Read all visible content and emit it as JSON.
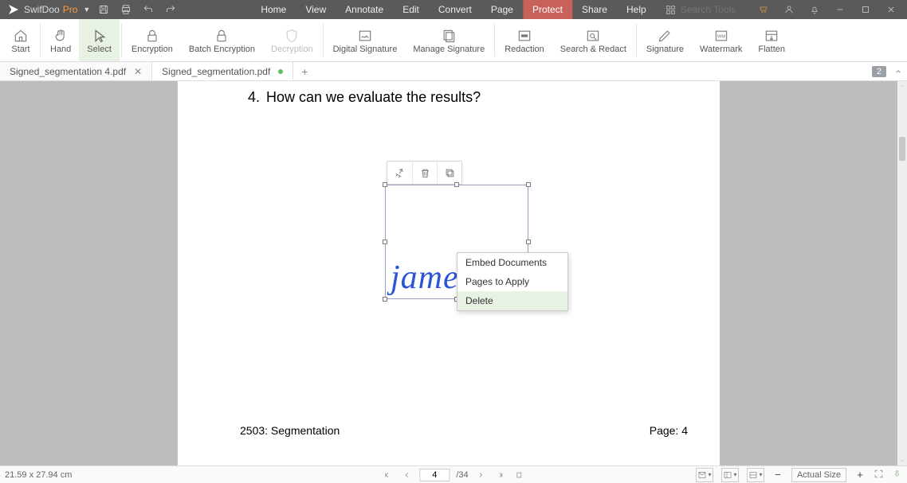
{
  "app": {
    "brand_main": "SwifDoo",
    "brand_suffix": " Pro",
    "search_placeholder": "Search Tools"
  },
  "menus": [
    "Home",
    "View",
    "Annotate",
    "Edit",
    "Convert",
    "Page",
    "Protect",
    "Share",
    "Help"
  ],
  "menus_active_index": 6,
  "ribbon": [
    {
      "label": "Start",
      "icon": "home"
    },
    {
      "label": "Hand",
      "icon": "hand"
    },
    {
      "label": "Select",
      "icon": "cursor",
      "active": true
    },
    {
      "label": "Encryption",
      "icon": "lock"
    },
    {
      "label": "Batch Encryption",
      "icon": "lock"
    },
    {
      "label": "Decryption",
      "icon": "shield",
      "disabled": true
    },
    {
      "label": "Digital Signature",
      "icon": "signature"
    },
    {
      "label": "Manage Signature",
      "icon": "stack"
    },
    {
      "label": "Redaction",
      "icon": "redact"
    },
    {
      "label": "Search & Redact",
      "icon": "searchredact"
    },
    {
      "label": "Signature",
      "icon": "pen"
    },
    {
      "label": "Watermark",
      "icon": "watermark"
    },
    {
      "label": "Flatten",
      "icon": "flatten"
    }
  ],
  "ribbon_separators_after": [
    0,
    2,
    5,
    7,
    9
  ],
  "tabs": [
    {
      "label": "Signed_segmentation 4.pdf",
      "active": false,
      "modified": false
    },
    {
      "label": "Signed_segmentation.pdf",
      "active": true,
      "modified": true
    }
  ],
  "tab_count_badge": "2",
  "document": {
    "question_number": "4.",
    "question_text": "How can we evaluate the results?",
    "signature_text": "jame",
    "footer_left": "2503: Segmentation",
    "footer_right": "Page: 4"
  },
  "mini_toolbar_icons": [
    "pin",
    "trash",
    "copy"
  ],
  "context_menu": {
    "items": [
      "Embed Documents",
      "Pages to Apply",
      "Delete"
    ],
    "hover_index": 2
  },
  "status": {
    "dimensions": "21.59 x 27.94 cm",
    "page_current": "4",
    "page_total": "/34",
    "zoom_label": "Actual Size"
  }
}
